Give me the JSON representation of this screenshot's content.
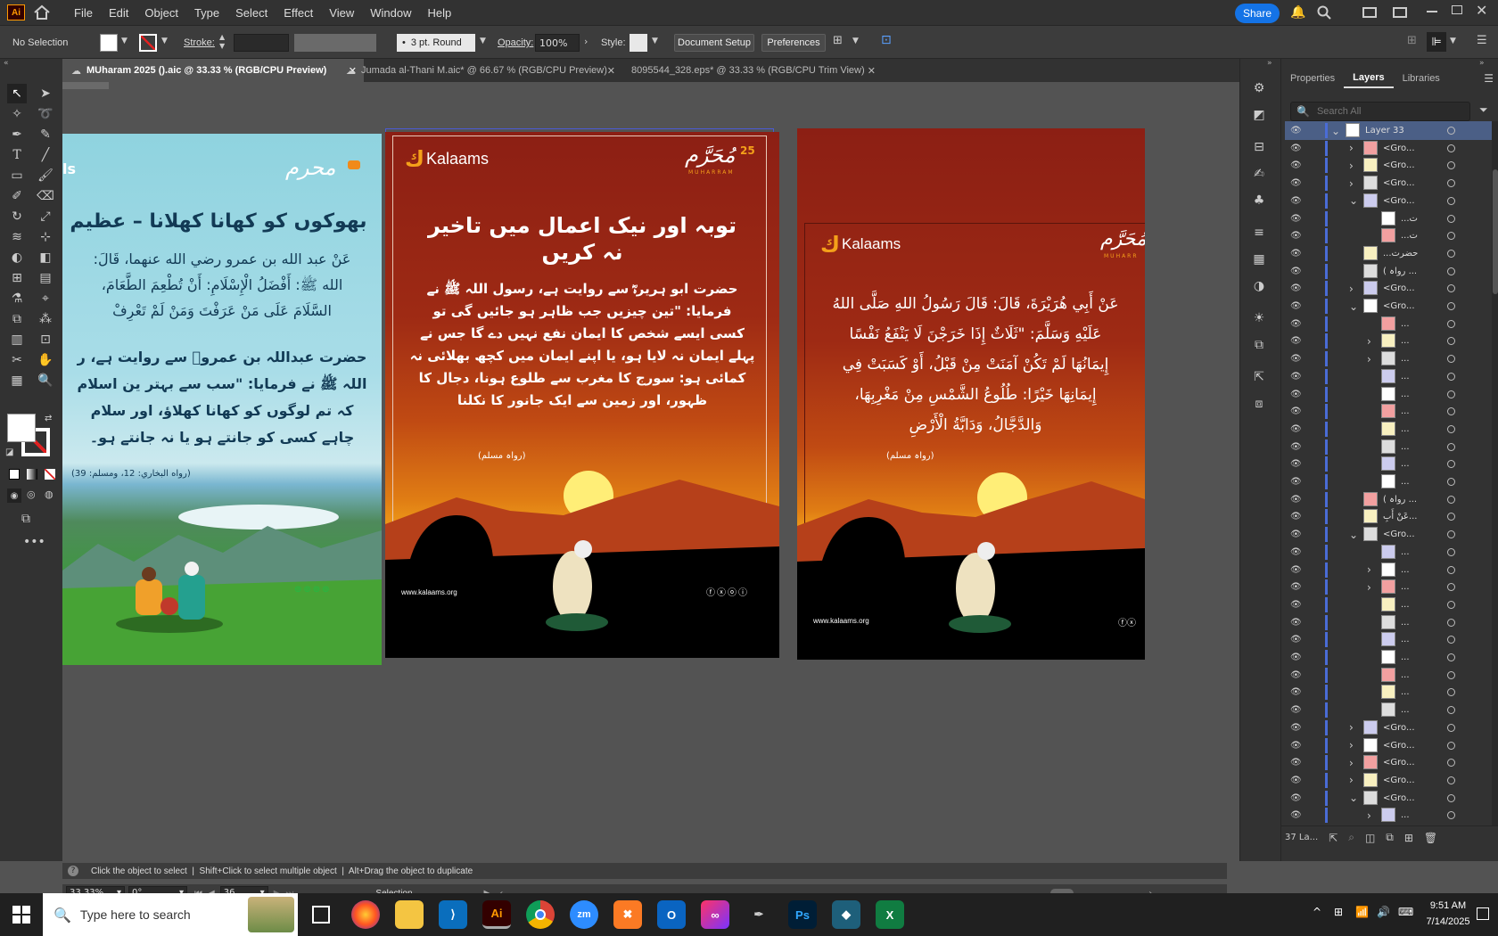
{
  "app": {
    "logo": "Ai"
  },
  "menu": [
    "File",
    "Edit",
    "Object",
    "Type",
    "Select",
    "Effect",
    "View",
    "Window",
    "Help"
  ],
  "topright": {
    "share": "Share"
  },
  "control": {
    "selection": "No Selection",
    "stroke_label": "Stroke:",
    "brush": "3 pt. Round",
    "opacity_label": "Opacity:",
    "opacity": "100%",
    "style_label": "Style:",
    "doc_setup": "Document Setup",
    "preferences": "Preferences"
  },
  "tabs": [
    {
      "label": "MUharam 2025 ().aic @ 33.33 % (RGB/CPU Preview)",
      "active": true
    },
    {
      "label": "Jumada al-Thani M.aic* @ 66.67 % (RGB/CPU Preview)",
      "active": false
    },
    {
      "label": "8095544_328.eps* @ 33.33 % (RGB/CPU Trim View)",
      "active": false
    }
  ],
  "art1": {
    "left_label": "ls",
    "title": "بھوکوں کو کھانا کھلانا – عظیم",
    "arabic": [
      "عَنْ عبد الله بن عمرو رضي الله عنهما، قَالَ:",
      "الله ﷺ: أَفْضَلُ الْإِسْلَامِ: أَنْ تُطْعِمَ الطَّعَامَ،",
      "السَّلَامَ عَلَى مَنْ عَرَفْتَ وَمَنْ لَمْ تَعْرِفْ"
    ],
    "urdu": [
      "حضرت عبداللہ بن عمروؓ سے روایت ہے، ر",
      "اللہ ﷺ نے فرمایا: \"سب سے بہتر ین اسلام",
      "کہ تم لوگوں کو کھانا کھلاؤ، اور سلام",
      "چاہے کسی کو جانتے ہو یا نہ جانتے ہو۔"
    ],
    "source": "(رواه البخاري: 12، ومسلم: 39)",
    "badge": "محرم"
  },
  "art2": {
    "brand": "Kalaams",
    "badge": "مُحَرَّم",
    "badge_num": "25",
    "badge_sub": "MUHARRAM",
    "title": [
      "توبہ اور نیک اعمال میں تاخیر",
      "نہ کریں"
    ],
    "body": [
      "حضرت ابو ہریرہؓ سے روایت ہے، رسول اللہ ﷺ نے",
      "فرمایا: \"تین چیزیں جب ظاہر ہو جائیں گی تو",
      "کسی ایسے شخص کا ایمان نفع نہیں دے گا جس نے",
      "پہلے ایمان نہ لایا ہو، یا اپنے ایمان میں کچھ بھلائی نہ",
      "کمائی ہو: سورج کا مغرب سے طلوع ہونا، دجال کا",
      "ظہور، اور زمین سے ایک جانور کا نکلنا"
    ],
    "source": "(رواہ مسلم)",
    "url": "www.kalaams.org"
  },
  "art3": {
    "brand": "Kalaams",
    "badge": "مُحَرَّم",
    "badge_sub": "MUHARR",
    "arabic": [
      "عَنْ أَبِي هُرَيْرَةَ، قَالَ: قَالَ رَسُولُ اللهِ صَلَّى اللهُ",
      "عَلَيْهِ وَسَلَّمَ: \"ثَلَاثٌ إِذَا خَرَجْنَ لَا يَنْفَعُ نَفْسًا",
      "إِيمَانُهَا لَمْ تَكُنْ آمَنَتْ مِنْ قَبْلُ، أَوْ كَسَبَتْ فِي",
      "إِيمَانِهَا خَيْرًا: طُلُوعُ الشَّمْسِ مِنْ مَغْرِبِهَا،",
      "وَالدَّجَّالُ، وَدَابَّةُ الْأَرْضِ"
    ],
    "source": "(رواہ مسلم)",
    "url": "www.kalaams.org"
  },
  "panel": {
    "tabs": [
      "Properties",
      "Layers",
      "Libraries"
    ],
    "search_placeholder": "Search All",
    "footer": "37 La..."
  },
  "layers": [
    {
      "name": "Layer 33",
      "indent": 0,
      "chev": "down",
      "sel": true
    },
    {
      "name": "<Gro...",
      "indent": 1,
      "chev": "right"
    },
    {
      "name": "<Gro...",
      "indent": 1,
      "chev": "right"
    },
    {
      "name": "<Gro...",
      "indent": 1,
      "chev": "right"
    },
    {
      "name": "<Gro...",
      "indent": 1,
      "chev": "down"
    },
    {
      "name": "...ت",
      "indent": 2,
      "chev": ""
    },
    {
      "name": "...ت",
      "indent": 2,
      "chev": ""
    },
    {
      "name": "...حضرت",
      "indent": 1,
      "chev": ""
    },
    {
      "name": "( رواہ ...",
      "indent": 1,
      "chev": ""
    },
    {
      "name": "<Gro...",
      "indent": 1,
      "chev": "right"
    },
    {
      "name": "<Gro...",
      "indent": 1,
      "chev": "down"
    },
    {
      "name": "...",
      "indent": 2,
      "chev": ""
    },
    {
      "name": "...",
      "indent": 2,
      "chev": "right"
    },
    {
      "name": "...",
      "indent": 2,
      "chev": "right"
    },
    {
      "name": "...",
      "indent": 2,
      "chev": ""
    },
    {
      "name": "...",
      "indent": 2,
      "chev": ""
    },
    {
      "name": "...",
      "indent": 2,
      "chev": ""
    },
    {
      "name": "...",
      "indent": 2,
      "chev": ""
    },
    {
      "name": "...",
      "indent": 2,
      "chev": ""
    },
    {
      "name": "...",
      "indent": 2,
      "chev": ""
    },
    {
      "name": "...",
      "indent": 2,
      "chev": ""
    },
    {
      "name": "( رواہ ...",
      "indent": 1,
      "chev": ""
    },
    {
      "name": "عَنْ أَبِ...",
      "indent": 1,
      "chev": ""
    },
    {
      "name": "<Gro...",
      "indent": 1,
      "chev": "down"
    },
    {
      "name": "...",
      "indent": 2,
      "chev": ""
    },
    {
      "name": "...",
      "indent": 2,
      "chev": "right"
    },
    {
      "name": "...",
      "indent": 2,
      "chev": "right"
    },
    {
      "name": "...",
      "indent": 2,
      "chev": ""
    },
    {
      "name": "...",
      "indent": 2,
      "chev": ""
    },
    {
      "name": "...",
      "indent": 2,
      "chev": ""
    },
    {
      "name": "...",
      "indent": 2,
      "chev": ""
    },
    {
      "name": "...",
      "indent": 2,
      "chev": ""
    },
    {
      "name": "...",
      "indent": 2,
      "chev": ""
    },
    {
      "name": "...",
      "indent": 2,
      "chev": ""
    },
    {
      "name": "<Gro...",
      "indent": 1,
      "chev": "right"
    },
    {
      "name": "<Gro...",
      "indent": 1,
      "chev": "right"
    },
    {
      "name": "<Gro...",
      "indent": 1,
      "chev": "right"
    },
    {
      "name": "<Gro...",
      "indent": 1,
      "chev": "right"
    },
    {
      "name": "<Gro...",
      "indent": 1,
      "chev": "down"
    },
    {
      "name": "...",
      "indent": 2,
      "chev": "right"
    }
  ],
  "status": {
    "zoom": "33.33%",
    "angle": "0°",
    "artboard": "36",
    "tool": "Selection",
    "hint": "Click the object to select  |  Shift+Click to select multiple object  |  Alt+Drag the object to duplicate"
  },
  "taskbar": {
    "search_placeholder": "Type here to search",
    "time": "9:51 AM",
    "date": "7/14/2025"
  }
}
